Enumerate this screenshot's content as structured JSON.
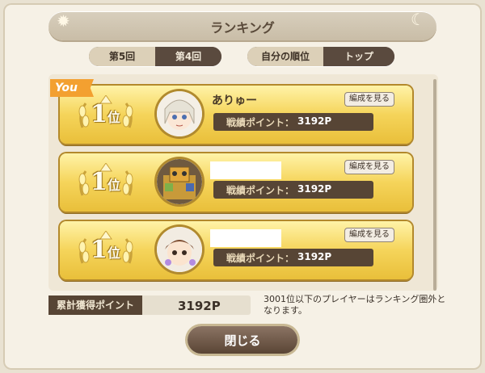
{
  "title": "ランキング",
  "tabs": {
    "round5": "第5回",
    "round4": "第4回",
    "active": "round4",
    "my_rank": "自分の順位",
    "top": "トップ",
    "top_active": "top"
  },
  "entries": [
    {
      "rank": "1",
      "rank_suffix": "位",
      "name": "ありゅー",
      "points_label": "戦績ポイント：",
      "points": "3192P",
      "view_label": "編成を見る",
      "is_you": true
    },
    {
      "rank": "1",
      "rank_suffix": "位",
      "name": "",
      "points_label": "戦績ポイント：",
      "points": "3192P",
      "view_label": "編成を見る",
      "is_you": false
    },
    {
      "rank": "1",
      "rank_suffix": "位",
      "name": "",
      "points_label": "戦績ポイント：",
      "points": "3192P",
      "view_label": "編成を見る",
      "is_you": false
    }
  ],
  "you_badge": "You",
  "total": {
    "label": "累計獲得ポイント",
    "value": "3192P"
  },
  "note": "3001位以下のプレイヤーはランキング圏外となります。",
  "close_label": "閉じる",
  "colors": {
    "card_gold": "#f5d45a",
    "points_bg": "#574535",
    "accent_orange": "#f3a030"
  }
}
